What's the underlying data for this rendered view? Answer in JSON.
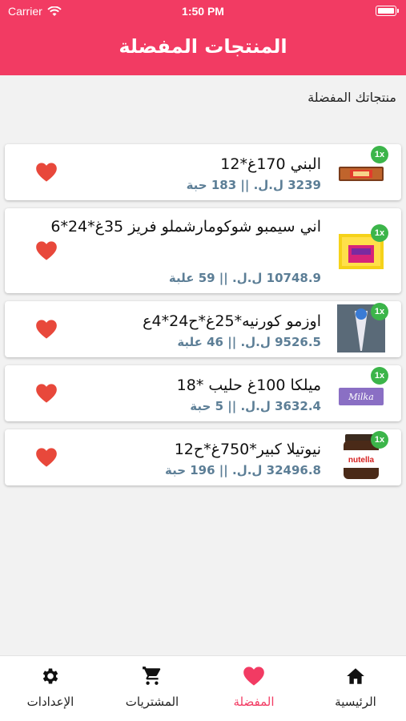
{
  "status_bar": {
    "carrier": "Carrier",
    "time": "1:50 PM"
  },
  "header": {
    "title": "المنتجات المفضلة"
  },
  "section": {
    "title": "منتجاتك المفضلة"
  },
  "colors": {
    "primary": "#f23b63",
    "price": "#5c7e96",
    "badge": "#3cb54a",
    "heart": "#e8483b"
  },
  "products": [
    {
      "name": "البني  170غ*12",
      "price": "3239",
      "currency": "ل.ل.",
      "sep": "||",
      "stock": "183 حبة",
      "qty": "1x"
    },
    {
      "name": "اني سيمبو شوكومارشملو فريز 35غ*24*6",
      "price": "10748.9",
      "currency": "ل.ل.",
      "sep": "||",
      "stock": "59 علبة",
      "qty": "1x"
    },
    {
      "name": "اوزمو كورنيه*25غ*ح24*4ع",
      "price": "9526.5",
      "currency": "ل.ل.",
      "sep": "||",
      "stock": "46 علبة",
      "qty": "1x"
    },
    {
      "name": "ميلكا 100غ حليب *18",
      "price": "3632.4",
      "currency": "ل.ل.",
      "sep": "||",
      "stock": "5 حبة",
      "qty": "1x"
    },
    {
      "name": "نيوتيلا كبير*750غ*ح12",
      "price": "32496.8",
      "currency": "ل.ل.",
      "sep": "||",
      "stock": "196 حبة",
      "qty": "1x"
    }
  ],
  "product_images": {
    "milka_text": "Milka",
    "nutella_text": "nutella"
  },
  "tabs": [
    {
      "label": "الرئيسية",
      "icon": "home-icon"
    },
    {
      "label": "المفضلة",
      "icon": "heart-icon"
    },
    {
      "label": "المشتريات",
      "icon": "cart-icon"
    },
    {
      "label": "الإعدادات",
      "icon": "gear-icon"
    }
  ]
}
